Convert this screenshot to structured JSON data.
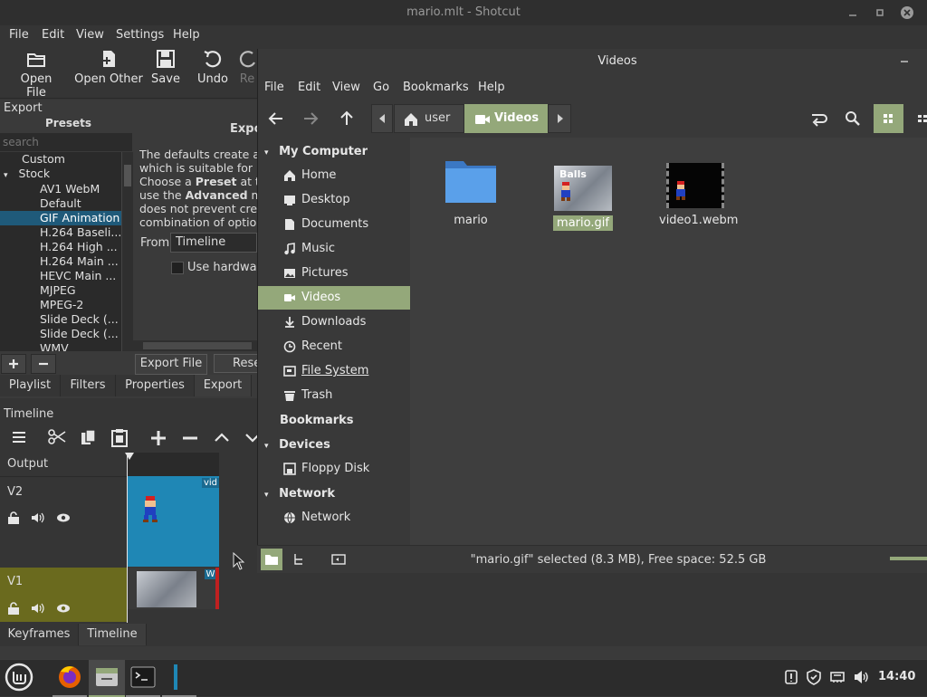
{
  "shotcut": {
    "title": "mario.mlt - Shotcut",
    "menu": [
      "File",
      "Edit",
      "View",
      "Settings",
      "Help"
    ],
    "toolbar": {
      "open_file": "Open File",
      "open_other": "Open Other",
      "save": "Save",
      "undo": "Undo",
      "redo_cut": "Re"
    },
    "export": {
      "title": "Export",
      "presets_title": "Presets",
      "right_title_cut": "Expo",
      "search_placeholder": "search",
      "presets": [
        "Custom",
        "Stock",
        "AV1 WebM",
        "Default",
        "GIF Animation",
        "H.264 Baseli...",
        "H.264 High ...",
        "H.264 Main ...",
        "HEVC Main ...",
        "MJPEG",
        "MPEG-2",
        "Slide Deck (...",
        "Slide Deck (...",
        "WMV"
      ],
      "desc_lines": [
        "The defaults create a",
        "which is suitable for m",
        "Choose a ",
        "Preset",
        " at th",
        "use the ",
        "Advanced",
        " mo",
        "does not prevent crea",
        "combination of option"
      ],
      "from_label": "From",
      "from_value": "Timeline",
      "hw_label": "Use hardware",
      "export_file": "Export File",
      "reset_cut": "Rese"
    },
    "tabs": [
      "Playlist",
      "Filters",
      "Properties",
      "Export"
    ],
    "timeline": {
      "label": "Timeline",
      "output": "Output",
      "v2": "V2",
      "v1": "V1",
      "clip_v2_label": "vid",
      "clip_v1_label": "Wi"
    },
    "bottom_tabs": [
      "Keyframes",
      "Timeline"
    ]
  },
  "fm": {
    "title": "Videos",
    "menu": [
      "File",
      "Edit",
      "View",
      "Go",
      "Bookmarks",
      "Help"
    ],
    "path": [
      "user",
      "Videos"
    ],
    "sidebar": {
      "my_computer": "My Computer",
      "items": [
        "Home",
        "Desktop",
        "Documents",
        "Music",
        "Pictures",
        "Videos",
        "Downloads",
        "Recent",
        "File System",
        "Trash"
      ],
      "bookmarks": "Bookmarks",
      "devices": "Devices",
      "device_items": [
        "Floppy Disk"
      ],
      "network": "Network",
      "network_items": [
        "Network"
      ]
    },
    "files": [
      {
        "name": "mario"
      },
      {
        "name": "mario.gif",
        "thumb_text": "Balls"
      },
      {
        "name": "video1.webm"
      }
    ],
    "status": "\"mario.gif\" selected (8.3 MB), Free space: 52.5 GB"
  },
  "taskbar": {
    "clock": "14:40"
  },
  "colors": {
    "accent_green": "#94a87a",
    "selection_blue": "#1f5a7a",
    "track_blue": "#1f87b5",
    "v1_olive": "#6a6a1e"
  }
}
